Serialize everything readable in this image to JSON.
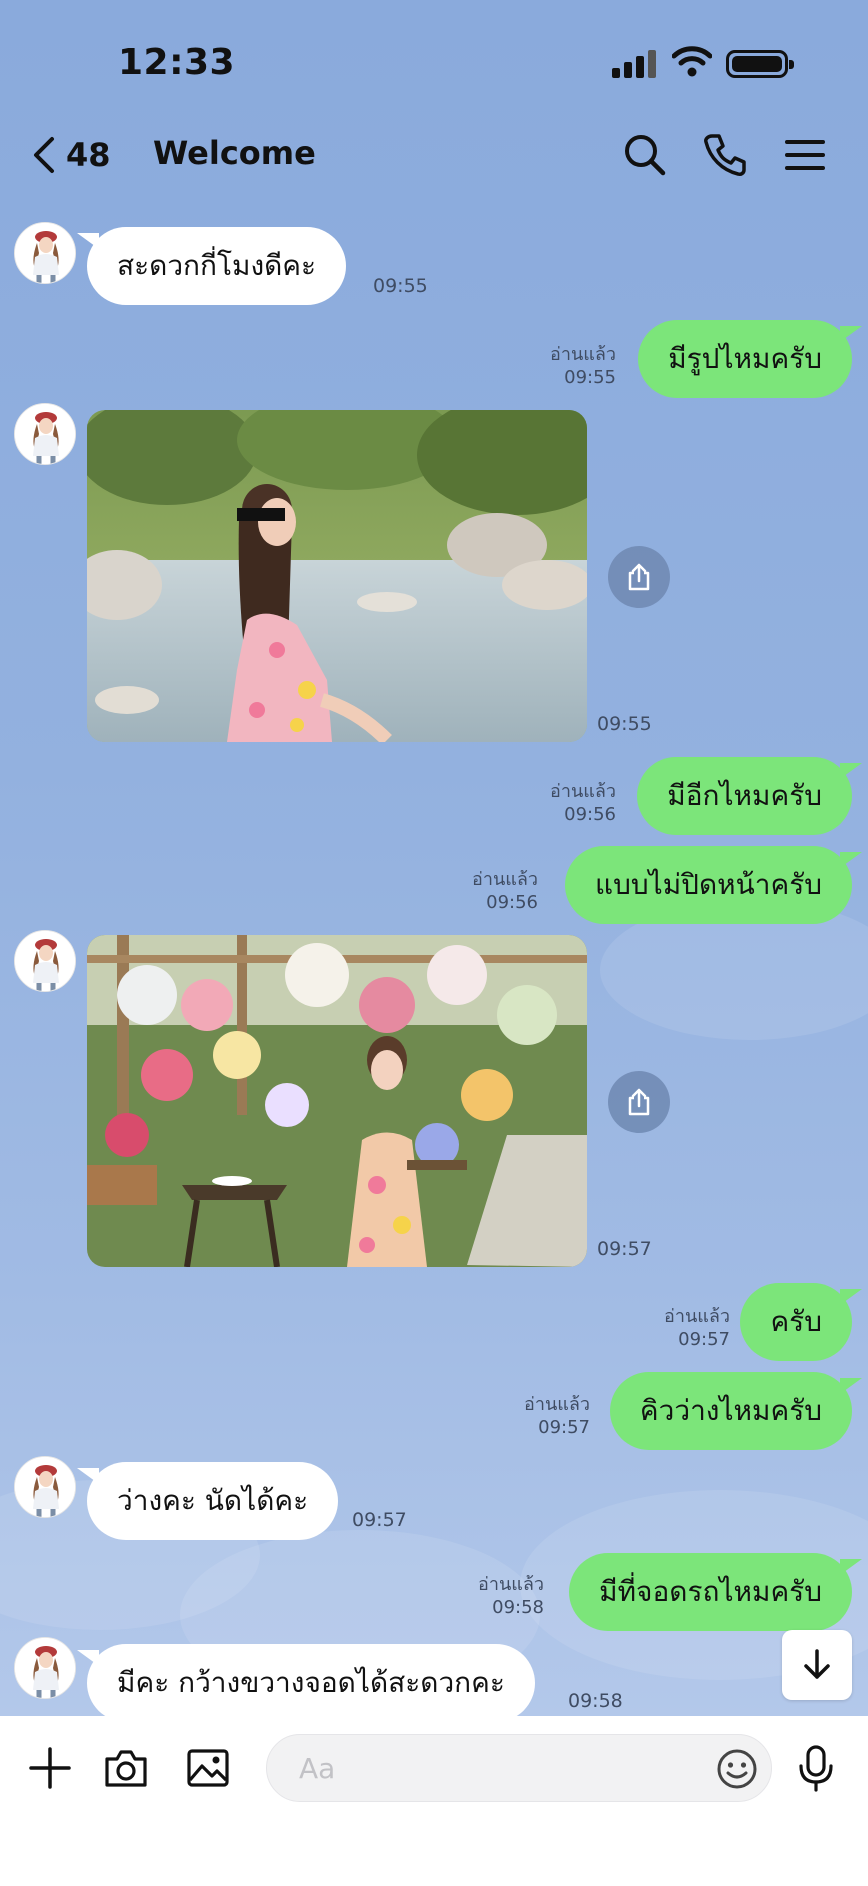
{
  "status_bar": {
    "time": "12:33"
  },
  "header": {
    "back_count": "48",
    "title": "Welcome"
  },
  "messages": [
    {
      "text": "สะดวกกี่โมงดีคะ",
      "time": "09:55"
    },
    {
      "text": "มีรูปไหมครับ",
      "read": "อ่านแล้ว",
      "time": "09:55"
    },
    {
      "time": "09:55"
    },
    {
      "text": "มีอีกไหมครับ",
      "read": "อ่านแล้ว",
      "time": "09:56"
    },
    {
      "text": "แบบไม่ปิดหน้าครับ",
      "read": "อ่านแล้ว",
      "time": "09:56"
    },
    {
      "time": "09:57"
    },
    {
      "text": "ครับ",
      "read": "อ่านแล้ว",
      "time": "09:57"
    },
    {
      "text": "คิวว่างไหมครับ",
      "read": "อ่านแล้ว",
      "time": "09:57"
    },
    {
      "text": "ว่างคะ นัดได้คะ",
      "time": "09:57"
    },
    {
      "text": "มีที่จอดรถไหมครับ",
      "read": "อ่านแล้ว",
      "time": "09:58"
    },
    {
      "text": "มีคะ กว้างขวางจอดได้สะดวกคะ",
      "time": "09:58"
    }
  ],
  "input_bar": {
    "placeholder": "Aa"
  },
  "icons": {
    "header": [
      "chevron-left-icon",
      "search-icon",
      "phone-icon",
      "menu-icon"
    ],
    "input_bar": [
      "plus-icon",
      "camera-icon",
      "image-icon",
      "emoji-icon",
      "microphone-icon"
    ],
    "other": [
      "share-icon",
      "arrow-down-icon"
    ]
  },
  "colors": {
    "chat_background": "#8eaede",
    "outgoing_bubble": "#7ce57a",
    "incoming_bubble": "#ffffff"
  }
}
